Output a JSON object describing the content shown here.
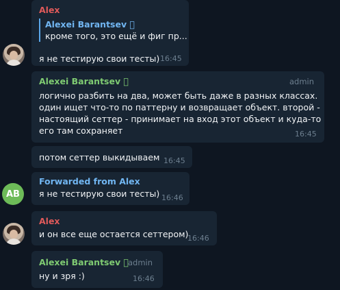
{
  "messages": [
    {
      "author": "Alex",
      "quote": {
        "author": "Alexei Barantsev \u0000",
        "text": "кроме того, это ещё и фиг пр..."
      },
      "text": "я не тестирую свои тесты)",
      "time": "16:45"
    },
    {
      "author": "Alexei Barantsev \u0000",
      "badge": "admin",
      "lines": [
        "логично разбить на два, может быть даже в разных классах.",
        "один ищет что-то по паттерну и возвращает объект. второй -",
        "настоящий сеттер - принимает на вход этот объект и куда-то",
        "его там сохраняет"
      ],
      "time": "16:45"
    },
    {
      "text": "потом сеттер выкидываем",
      "time": "16:45"
    },
    {
      "forwarded": "Forwarded from Alex",
      "avatar_initials": "AB",
      "text": "я не тестирую свои тесты)",
      "time": "16:46"
    },
    {
      "author": "Alex",
      "text": "и он все еще остается сеттером)",
      "time": "16:46"
    },
    {
      "author": "Alexei Barantsev \u0000",
      "badge": "admin",
      "text": "ну и зря :)",
      "time": "16:46"
    }
  ],
  "colors": {
    "background": "#0e1621",
    "bubble": "#182533",
    "alex_name": "#e05a5a",
    "barantsev_name": "#7fcb72",
    "forwarded": "#71b6f2",
    "avatar_ab": "#6dbb58"
  }
}
